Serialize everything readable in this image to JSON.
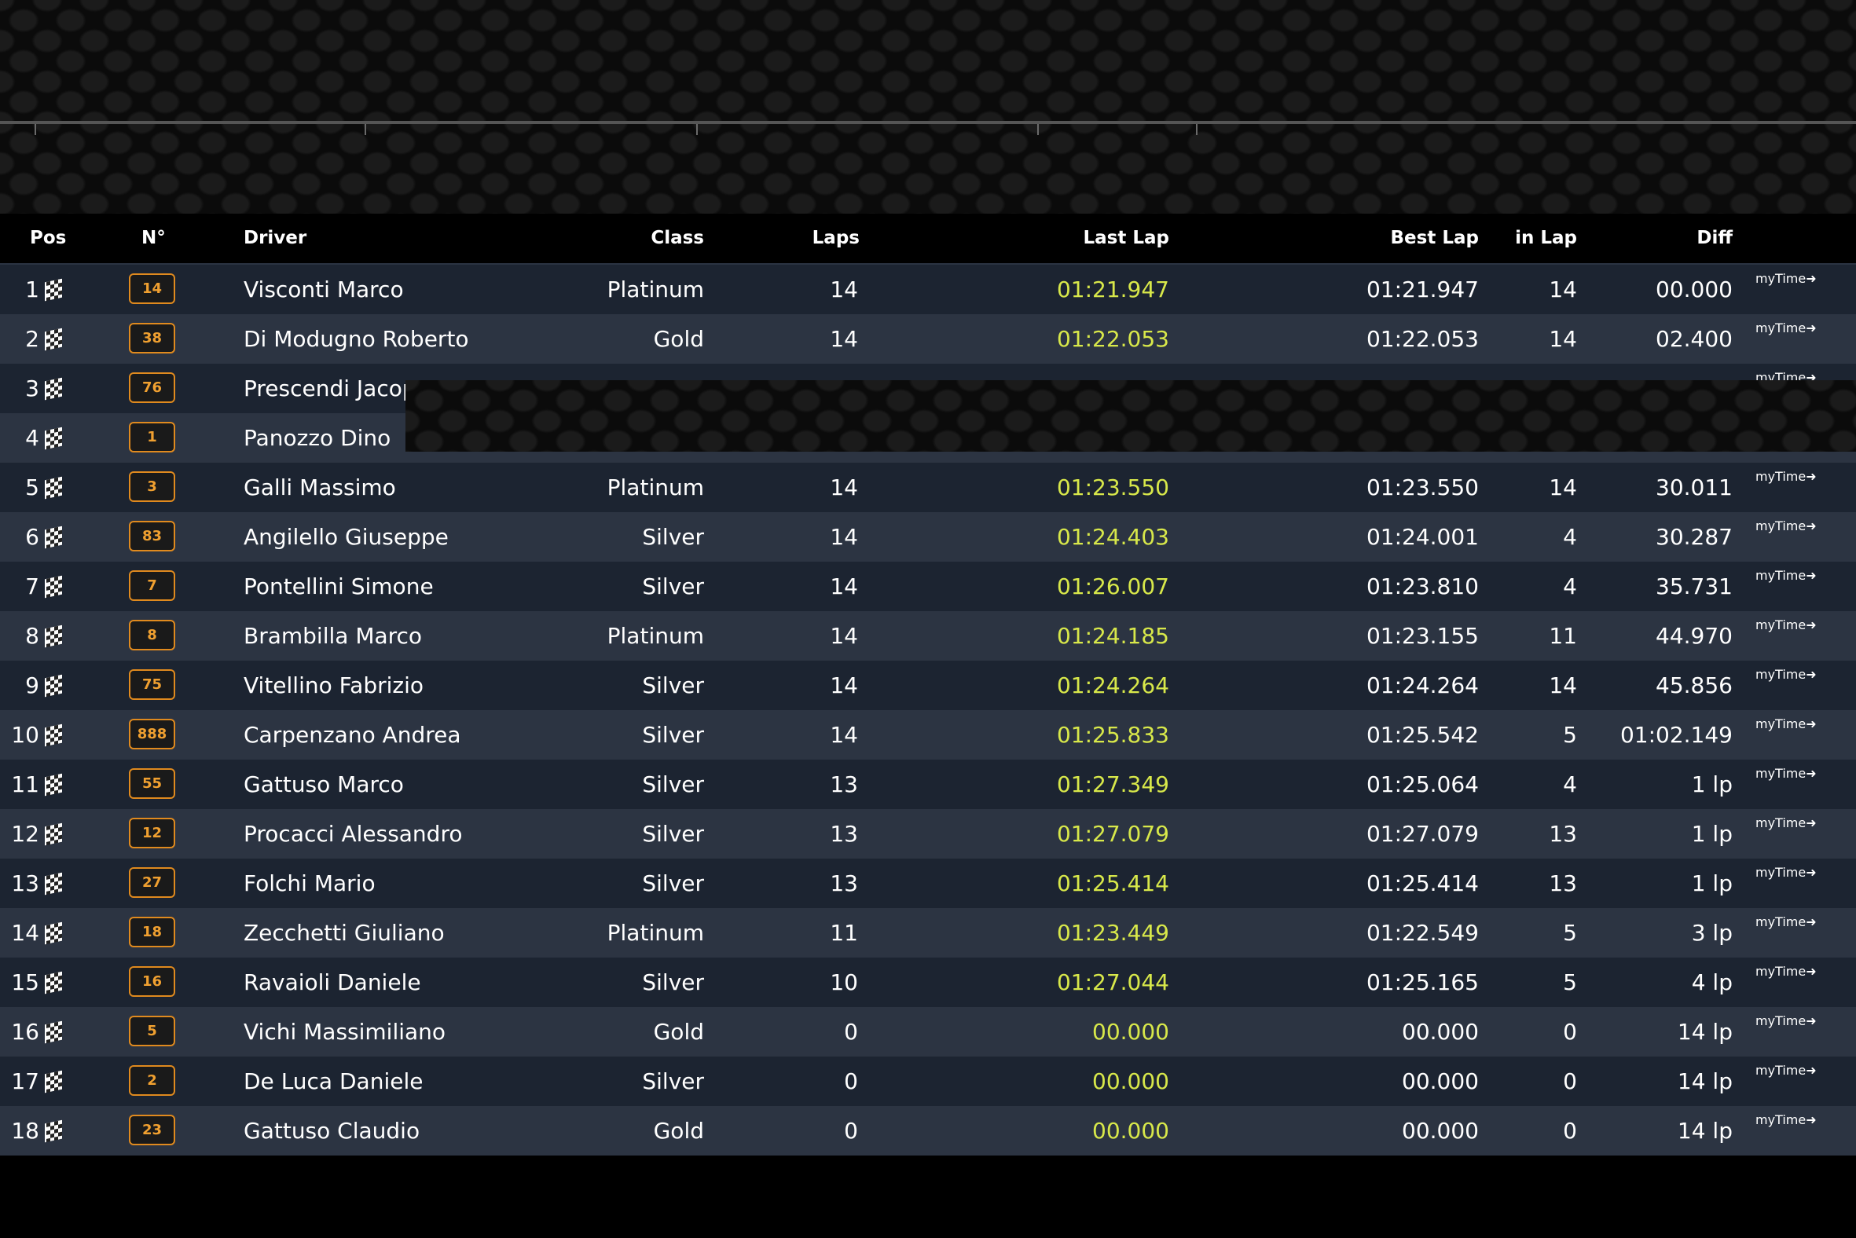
{
  "headers": {
    "pos": "Pos",
    "num": "N°",
    "driver": "Driver",
    "class": "Class",
    "laps": "Laps",
    "last_lap": "Last Lap",
    "best_lap": "Best Lap",
    "in_lap": "in Lap",
    "diff": "Diff"
  },
  "mytime_label": "myTime",
  "rows": [
    {
      "pos": "1",
      "num": "14",
      "driver": "Visconti Marco",
      "class": "Platinum",
      "laps": "14",
      "last": "01:21.947",
      "best": "01:21.947",
      "inlap": "14",
      "diff": "00.000"
    },
    {
      "pos": "2",
      "num": "38",
      "driver": "Di Modugno Roberto",
      "class": "Gold",
      "laps": "14",
      "last": "01:22.053",
      "best": "01:22.053",
      "inlap": "14",
      "diff": "02.400"
    },
    {
      "pos": "3",
      "num": "76",
      "driver": "Prescendi Jacop",
      "class": "",
      "laps": "",
      "last": "",
      "best": "",
      "inlap": "",
      "diff": ""
    },
    {
      "pos": "4",
      "num": "1",
      "driver": "Panozzo Dino",
      "class": "",
      "laps": "",
      "last": "",
      "best": "",
      "inlap": "",
      "diff": ""
    },
    {
      "pos": "5",
      "num": "3",
      "driver": "Galli Massimo",
      "class": "Platinum",
      "laps": "14",
      "last": "01:23.550",
      "best": "01:23.550",
      "inlap": "14",
      "diff": "30.011"
    },
    {
      "pos": "6",
      "num": "83",
      "driver": "Angilello Giuseppe",
      "class": "Silver",
      "laps": "14",
      "last": "01:24.403",
      "best": "01:24.001",
      "inlap": "4",
      "diff": "30.287"
    },
    {
      "pos": "7",
      "num": "7",
      "driver": "Pontellini Simone",
      "class": "Silver",
      "laps": "14",
      "last": "01:26.007",
      "best": "01:23.810",
      "inlap": "4",
      "diff": "35.731"
    },
    {
      "pos": "8",
      "num": "8",
      "driver": "Brambilla Marco",
      "class": "Platinum",
      "laps": "14",
      "last": "01:24.185",
      "best": "01:23.155",
      "inlap": "11",
      "diff": "44.970"
    },
    {
      "pos": "9",
      "num": "75",
      "driver": "Vitellino Fabrizio",
      "class": "Silver",
      "laps": "14",
      "last": "01:24.264",
      "best": "01:24.264",
      "inlap": "14",
      "diff": "45.856"
    },
    {
      "pos": "10",
      "num": "888",
      "driver": "Carpenzano Andrea",
      "class": "Silver",
      "laps": "14",
      "last": "01:25.833",
      "best": "01:25.542",
      "inlap": "5",
      "diff": "01:02.149"
    },
    {
      "pos": "11",
      "num": "55",
      "driver": "Gattuso Marco",
      "class": "Silver",
      "laps": "13",
      "last": "01:27.349",
      "best": "01:25.064",
      "inlap": "4",
      "diff": "1 lp"
    },
    {
      "pos": "12",
      "num": "12",
      "driver": "Procacci Alessandro",
      "class": "Silver",
      "laps": "13",
      "last": "01:27.079",
      "best": "01:27.079",
      "inlap": "13",
      "diff": "1 lp"
    },
    {
      "pos": "13",
      "num": "27",
      "driver": "Folchi Mario",
      "class": "Silver",
      "laps": "13",
      "last": "01:25.414",
      "best": "01:25.414",
      "inlap": "13",
      "diff": "1 lp"
    },
    {
      "pos": "14",
      "num": "18",
      "driver": "Zecchetti Giuliano",
      "class": "Platinum",
      "laps": "11",
      "last": "01:23.449",
      "best": "01:22.549",
      "inlap": "5",
      "diff": "3 lp"
    },
    {
      "pos": "15",
      "num": "16",
      "driver": "Ravaioli Daniele",
      "class": "Silver",
      "laps": "10",
      "last": "01:27.044",
      "best": "01:25.165",
      "inlap": "5",
      "diff": "4 lp"
    },
    {
      "pos": "16",
      "num": "5",
      "driver": "Vichi Massimiliano",
      "class": "Gold",
      "laps": "0",
      "last": "00.000",
      "best": "00.000",
      "inlap": "0",
      "diff": "14 lp"
    },
    {
      "pos": "17",
      "num": "2",
      "driver": "De Luca Daniele",
      "class": "Silver",
      "laps": "0",
      "last": "00.000",
      "best": "00.000",
      "inlap": "0",
      "diff": "14 lp"
    },
    {
      "pos": "18",
      "num": "23",
      "driver": "Gattuso Claudio",
      "class": "Gold",
      "laps": "0",
      "last": "00.000",
      "best": "00.000",
      "inlap": "0",
      "diff": "14 lp"
    }
  ],
  "colors": {
    "last_lap": "#d8e84a",
    "badge": "#e08a1e",
    "row_odd": "#1c2431",
    "row_even": "#2c3442"
  },
  "icons": {
    "position_flag": "checkered-flag-icon",
    "mytime_arrow": "arrow-right-icon"
  }
}
